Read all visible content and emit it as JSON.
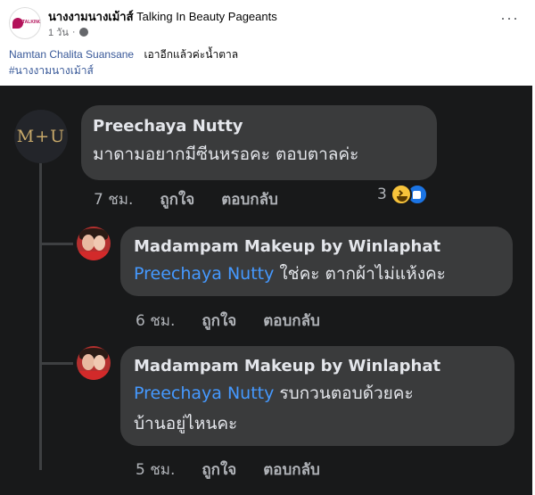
{
  "post": {
    "page_name": "นางงามนางเม้าส์",
    "group_name": "Talking In Beauty Pageants",
    "time": "1 วัน",
    "more_icon": "more-horizontal-icon",
    "privacy_icon": "globe-icon",
    "mention": "Namtan Chalita Suansane",
    "text": "เอาอีกแล้วค่ะน้ำตาล",
    "hashtag": "#นางงามนางเม้าส์"
  },
  "screenshot": {
    "comment": {
      "avatar_text": "M+U",
      "author": "Preechaya Nutty",
      "text": "มาดามอยากมีซีนหรอคะ ตอบตาลค่ะ",
      "time": "7 ชม.",
      "like_label": "ถูกใจ",
      "reply_label": "ตอบกลับ",
      "reaction_count": "3",
      "reaction_icons": [
        "haha-icon",
        "like-icon"
      ]
    },
    "replies": [
      {
        "author": "Madampam Makeup by Winlaphat",
        "tag": "Preechaya Nutty",
        "lines": [
          "ใช่คะ ตากผ้าไม่แห้งคะ"
        ],
        "time": "6 ชม.",
        "like_label": "ถูกใจ",
        "reply_label": "ตอบกลับ"
      },
      {
        "author": "Madampam Makeup by Winlaphat",
        "tag": "Preechaya Nutty",
        "lines": [
          "รบกวนตอบด้วยคะ",
          "บ้านอยู่ไหนคะ"
        ],
        "time": "5 ชม.",
        "like_label": "ถูกใจ",
        "reply_label": "ตอบกลับ"
      }
    ]
  },
  "colors": {
    "dark_bg": "#18191a",
    "bubble": "#3a3b3c",
    "link": "#4599ff",
    "mention": "#385898"
  }
}
